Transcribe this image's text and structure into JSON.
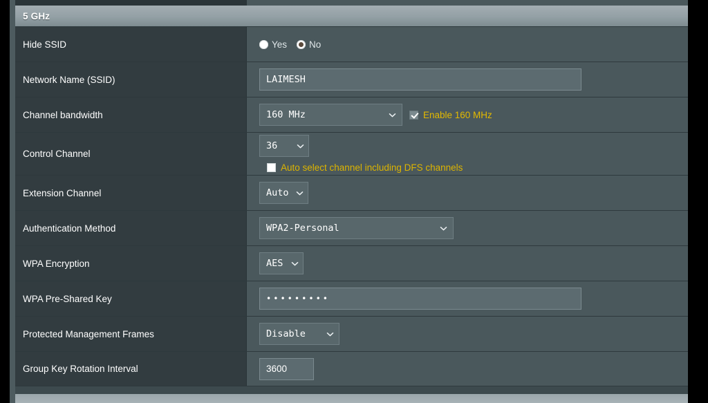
{
  "panel": {
    "header_title": "5 GHz"
  },
  "colors": {
    "accent_gold": "#e3b900",
    "label_bg": "#323c40",
    "value_bg": "#4a585c",
    "header_gradient_top": "#a3adb2",
    "header_gradient_bottom": "#7e8c91",
    "input_bg": "#5c6b70",
    "text": "#ffffff"
  },
  "rows": [
    {
      "label": "Hide SSID",
      "type": "radio",
      "options": [
        {
          "label": "Yes",
          "checked": false
        },
        {
          "label": "No",
          "checked": true
        }
      ]
    },
    {
      "label": "Network Name (SSID)",
      "type": "text",
      "value": "LAIMESH"
    },
    {
      "label": "Channel bandwidth",
      "type": "select_with_checkbox",
      "value": "160 MHz",
      "checkbox_label": "Enable 160 MHz",
      "checkbox_checked": true
    },
    {
      "label": "Control Channel",
      "type": "select_over_checkbox",
      "value": "36",
      "checkbox_label": "Auto select channel including DFS channels",
      "checkbox_checked": false
    },
    {
      "label": "Extension Channel",
      "type": "select",
      "value": "Auto"
    },
    {
      "label": "Authentication Method",
      "type": "select",
      "value": "WPA2-Personal"
    },
    {
      "label": "WPA Encryption",
      "type": "select",
      "value": "AES"
    },
    {
      "label": "WPA Pre-Shared Key",
      "type": "password",
      "value": "•••••••••"
    },
    {
      "label": "Protected Management Frames",
      "type": "select",
      "value": "Disable"
    },
    {
      "label": "Group Key Rotation Interval",
      "type": "text_small",
      "value": "3600"
    }
  ]
}
